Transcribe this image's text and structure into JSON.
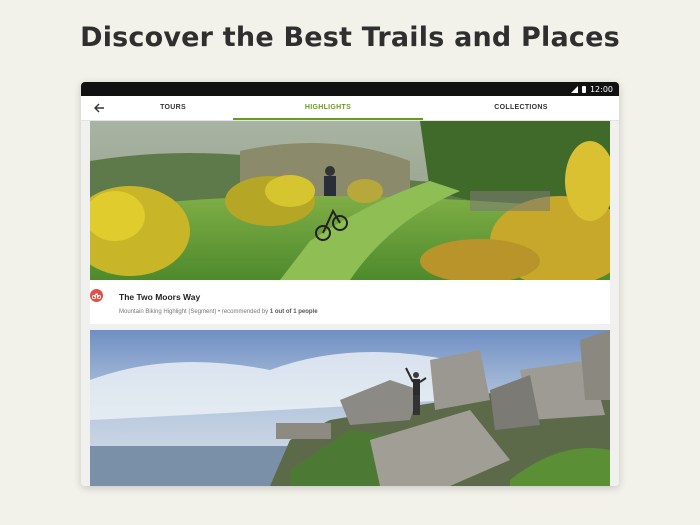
{
  "headline": "Discover the Best Trails and Places",
  "status": {
    "time": "12:00"
  },
  "tabs": [
    {
      "label": "TOURS"
    },
    {
      "label": "HIGHLIGHTS"
    },
    {
      "label": "COLLECTIONS"
    }
  ],
  "colors": {
    "accent": "#6a9b1c",
    "category_icon": "#e05048"
  },
  "icons": {
    "back": "arrow-left-icon",
    "category": "mountain-bike-icon"
  },
  "highlights": [
    {
      "title": "The Two Moors Way",
      "type": "Mountain Biking Highlight (Segment)",
      "separator": " • ",
      "recommended_prefix": "recommended by ",
      "recommended_count": "1 out of 1 people"
    }
  ]
}
